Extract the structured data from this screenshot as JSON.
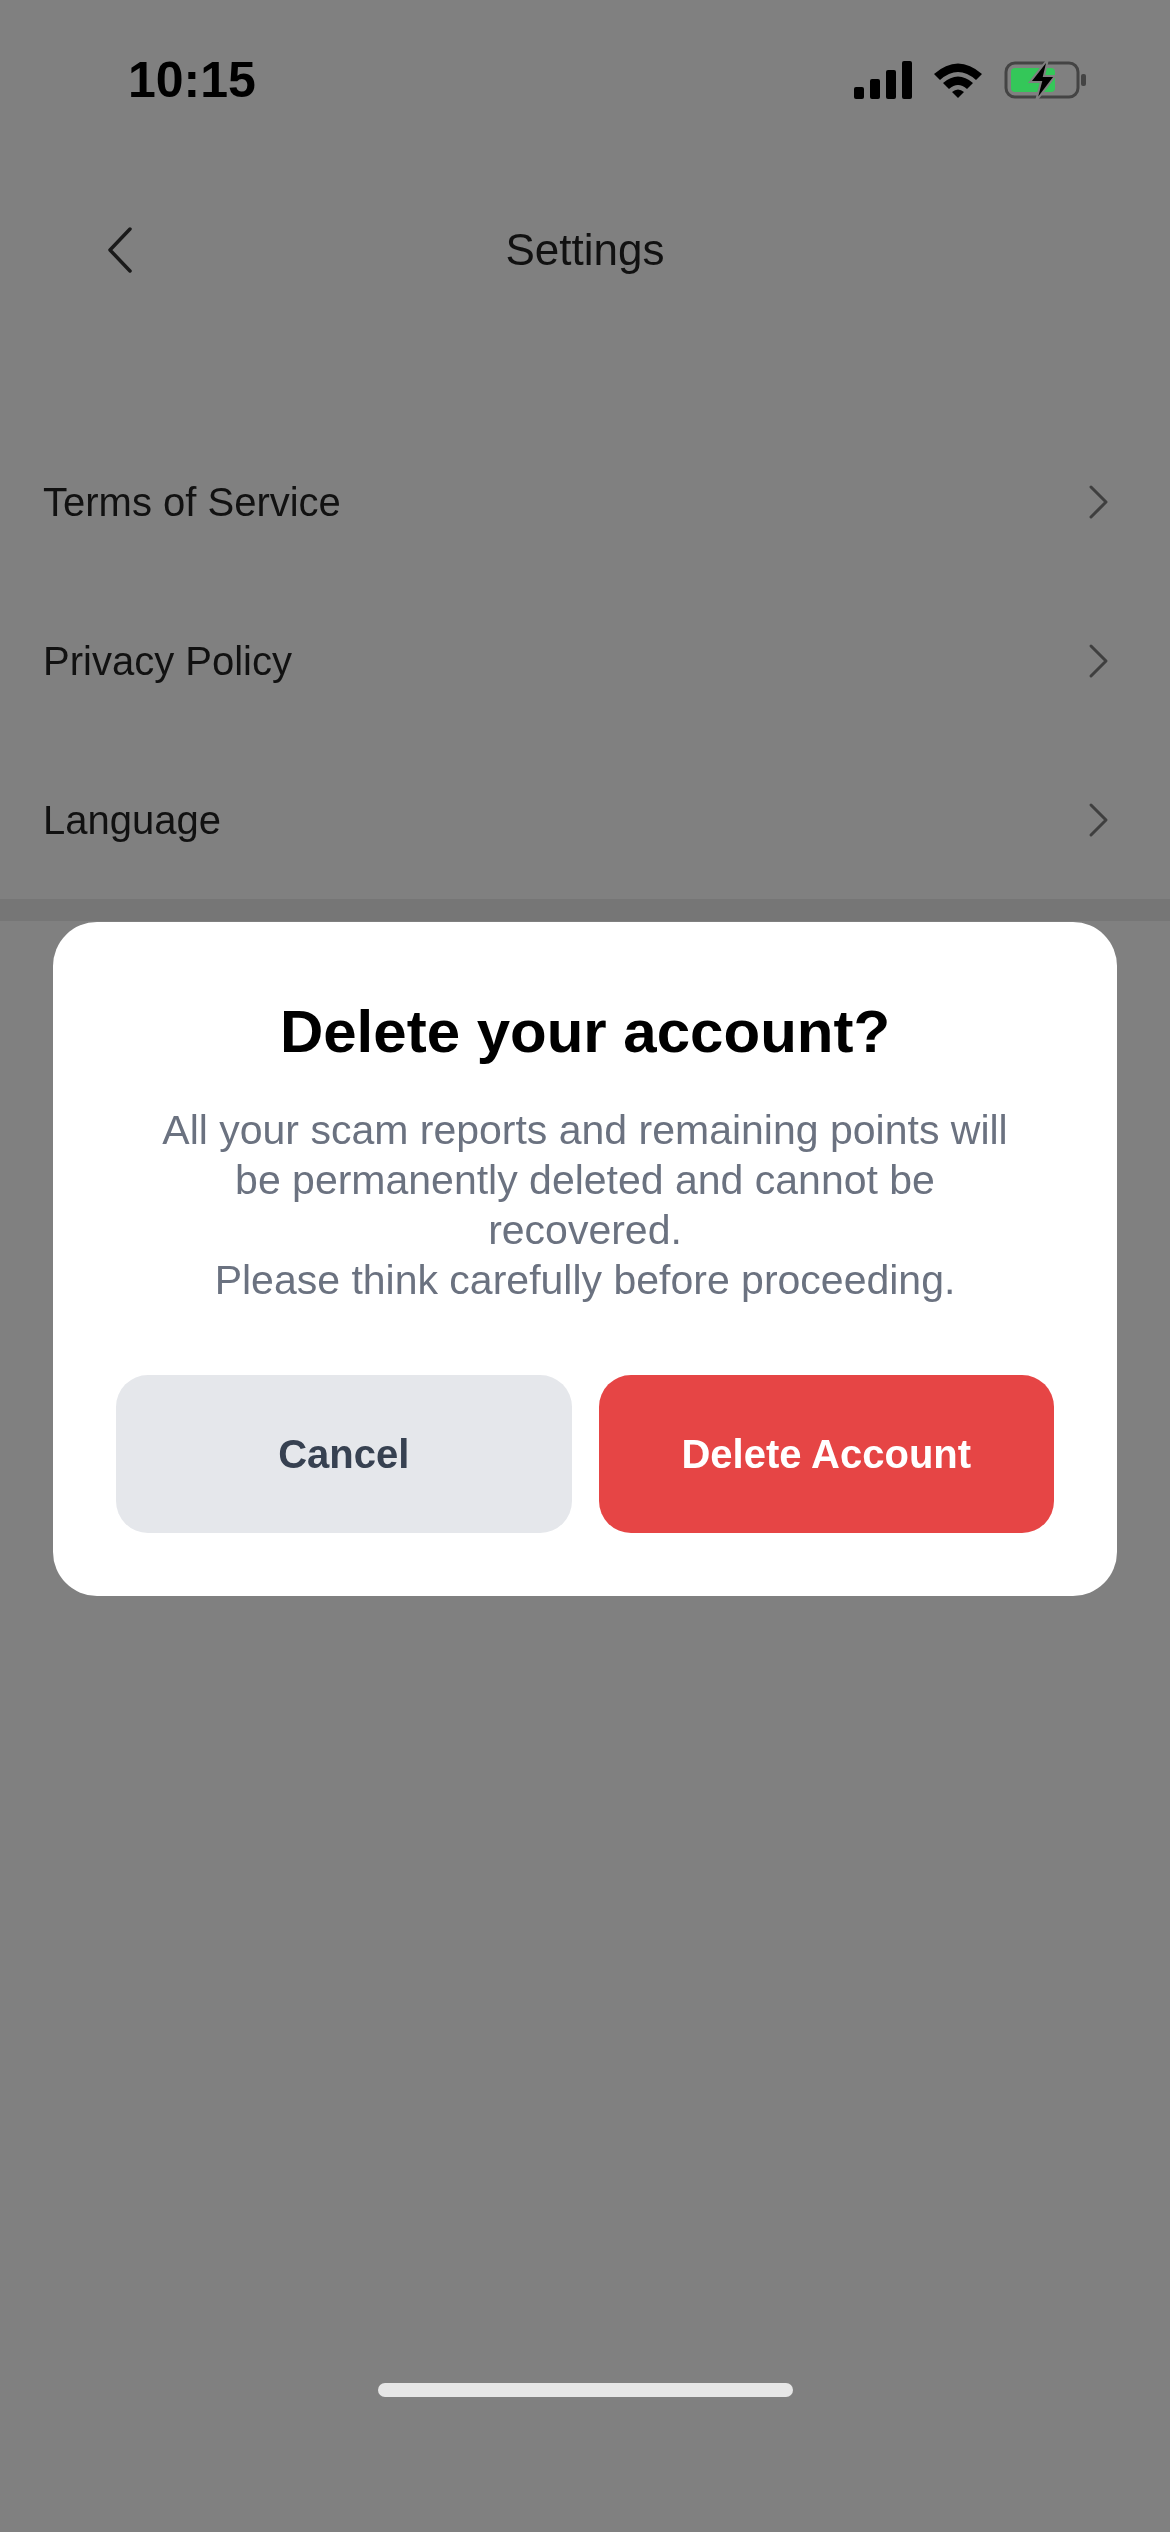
{
  "status_bar": {
    "time": "10:15"
  },
  "nav": {
    "title": "Settings"
  },
  "menu": [
    {
      "label": "Terms of Service"
    },
    {
      "label": "Privacy Policy"
    },
    {
      "label": "Language"
    }
  ],
  "dialog": {
    "title": "Delete your account?",
    "message": "All your scam reports and remaining points will be permanently deleted and cannot be recovered.\nPlease think carefully before proceeding.",
    "buttons": [
      {
        "label": "Cancel",
        "kind": "secondary"
      },
      {
        "label": "Delete Account",
        "kind": "danger"
      }
    ]
  }
}
